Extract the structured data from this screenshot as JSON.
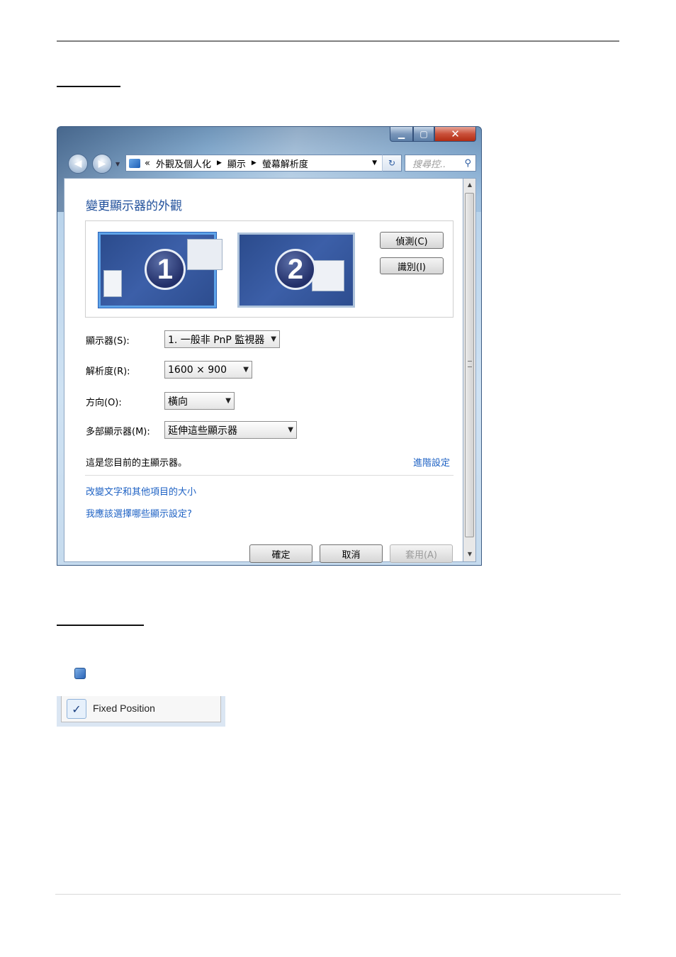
{
  "breadcrumb": {
    "prefix": "«",
    "items": [
      "外觀及個人化",
      "顯示",
      "螢幕解析度"
    ]
  },
  "search": {
    "placeholder": "搜尋控.."
  },
  "page": {
    "title": "變更顯示器的外觀"
  },
  "monitors": [
    {
      "number": "1"
    },
    {
      "number": "2"
    }
  ],
  "buttons": {
    "detect": "偵測(C)",
    "identify": "識別(I)",
    "ok": "確定",
    "cancel": "取消",
    "apply": "套用(A)"
  },
  "settings": {
    "display_label": "顯示器(S):",
    "display_value": "1. 一般非 PnP 監視器",
    "resolution_label": "解析度(R):",
    "resolution_value": "1600 × 900",
    "orientation_label": "方向(O):",
    "orientation_value": "橫向",
    "multi_label": "多部顯示器(M):",
    "multi_value": "延伸這些顯示器"
  },
  "status_text": "這是您目前的主顯示器。",
  "links": {
    "advanced": "進階設定",
    "text_size": "改變文字和其他項目的大小",
    "which_settings": "我應該選擇哪些顯示設定?"
  },
  "context_menu": {
    "item": "Fixed Position",
    "checked": true
  }
}
